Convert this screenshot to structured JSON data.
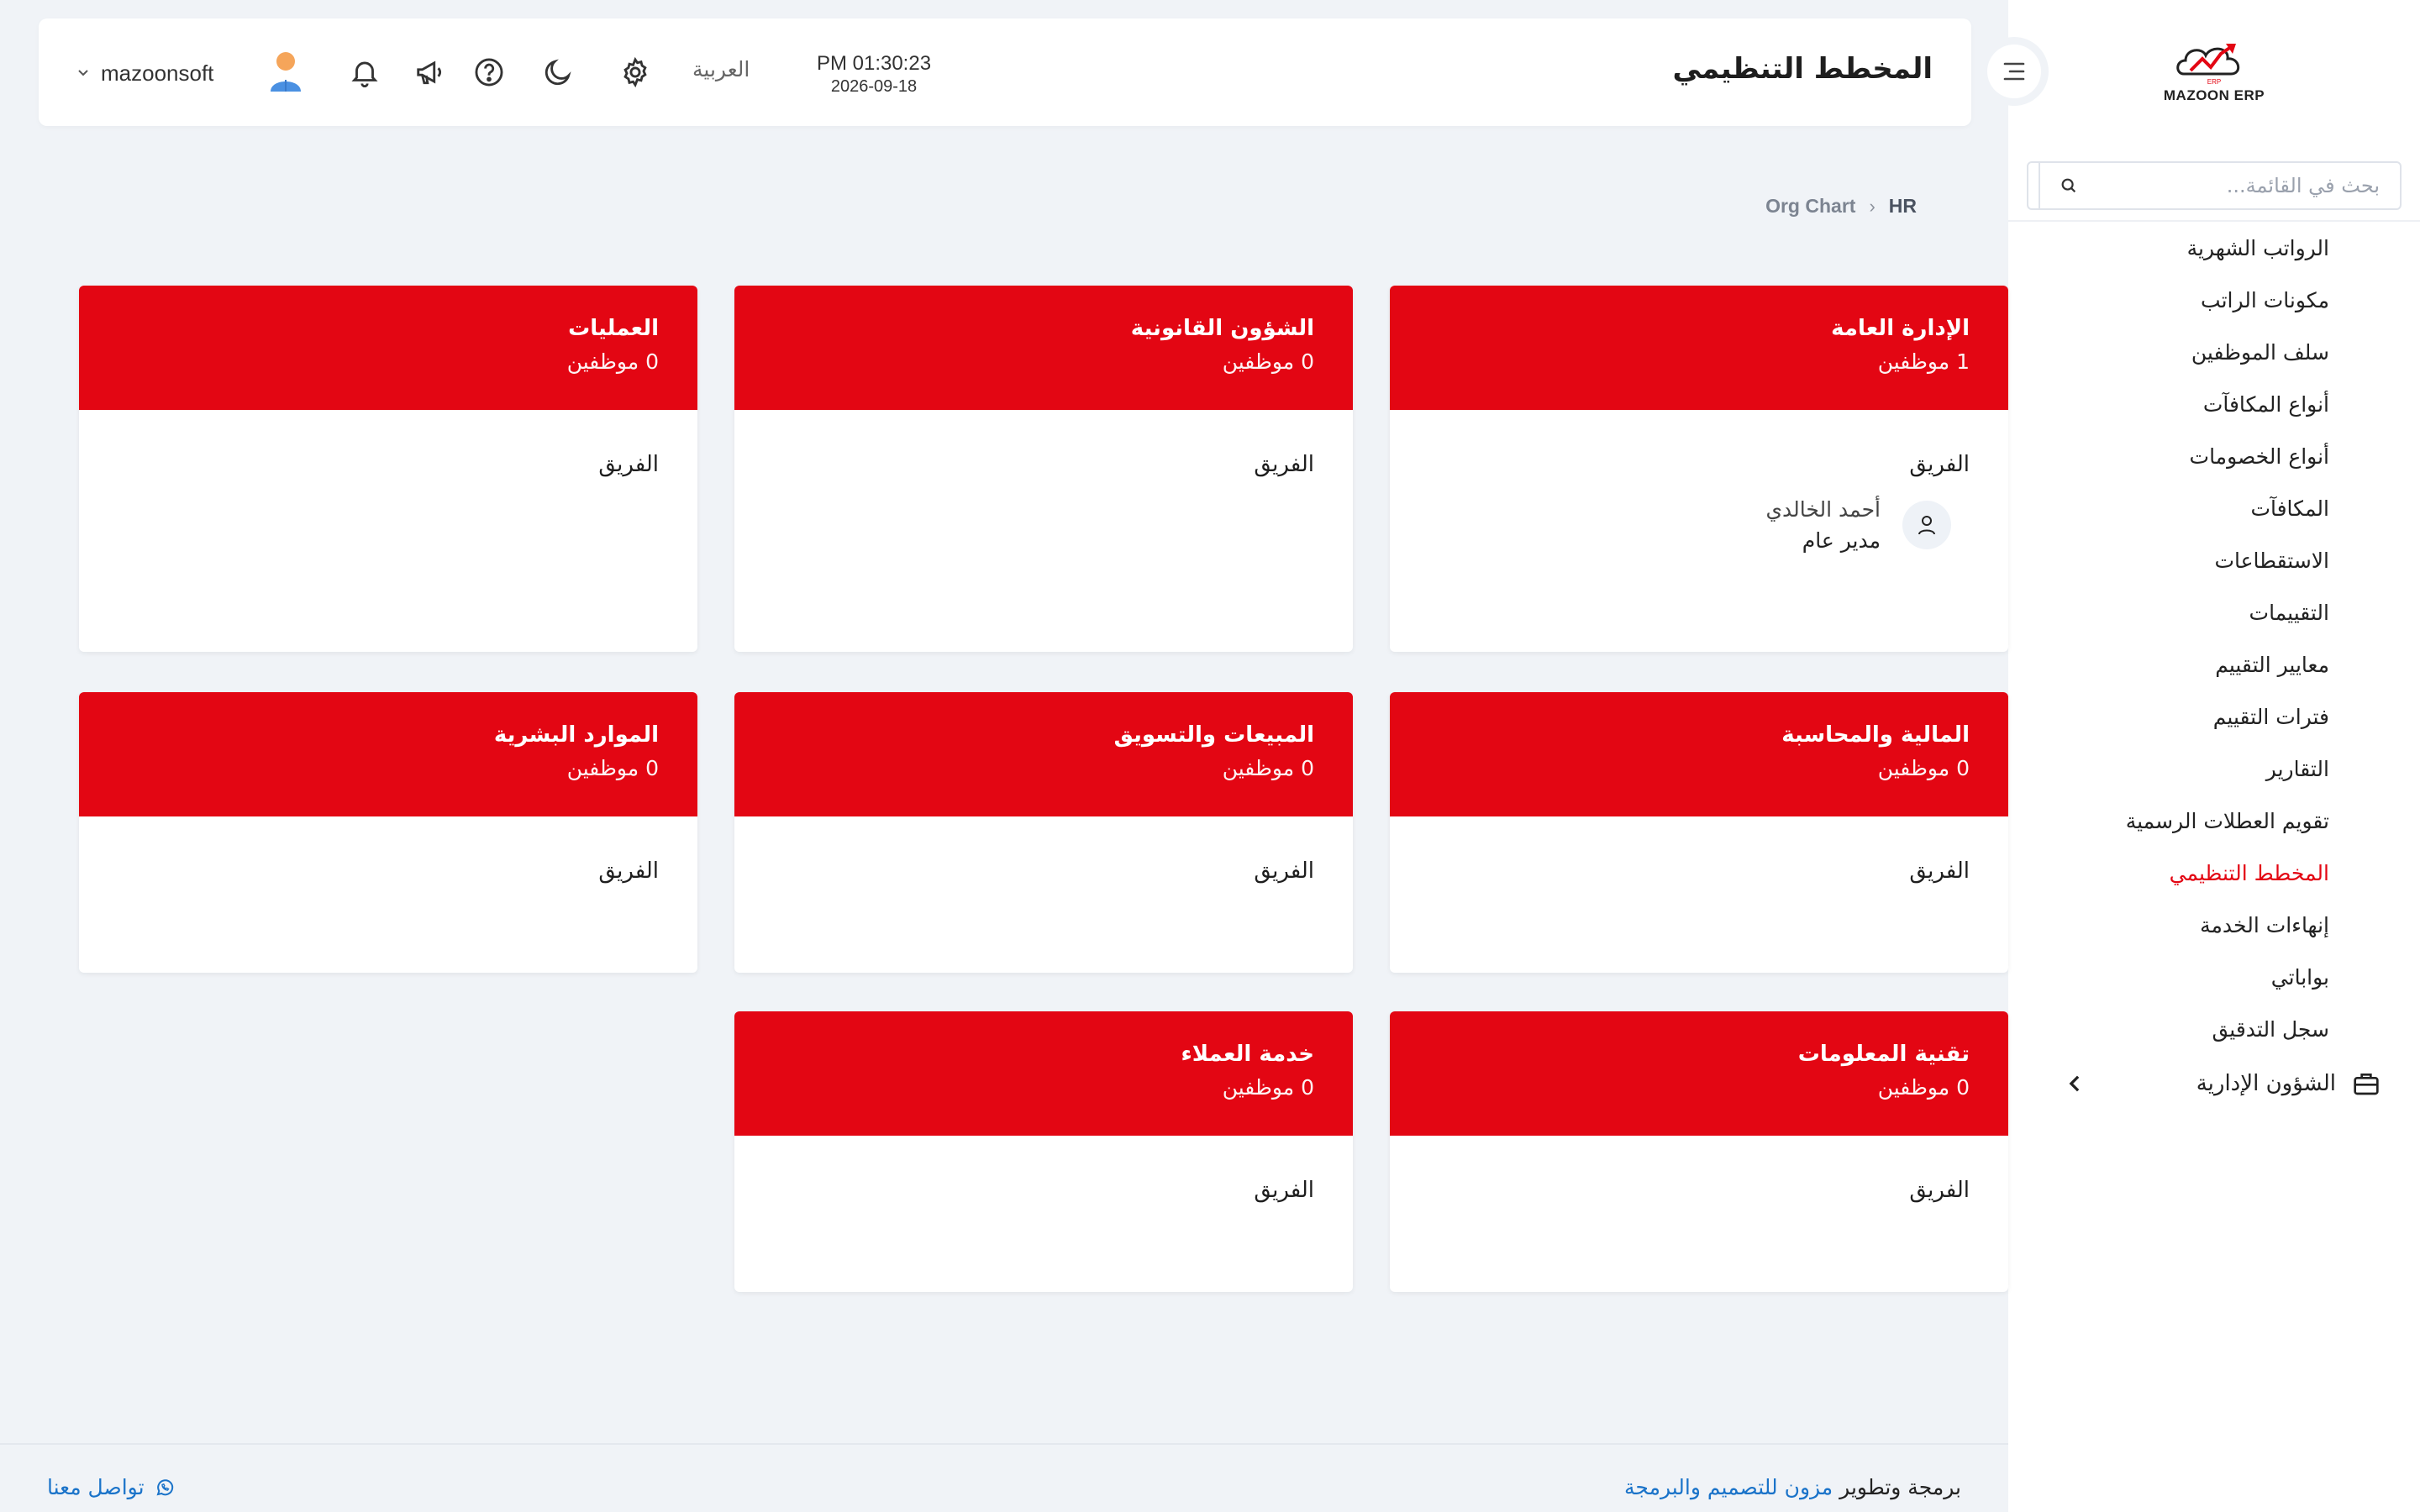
{
  "app": {
    "logo_text": "MAZOON ERP",
    "brand_color": "#e30613"
  },
  "sidebar": {
    "search_placeholder": "بحث في القائمة...",
    "items": [
      {
        "label": "الرواتب الشهرية"
      },
      {
        "label": "مكونات الراتب"
      },
      {
        "label": "سلف الموظفين"
      },
      {
        "label": "أنواع المكافآت"
      },
      {
        "label": "أنواع الخصومات"
      },
      {
        "label": "المكافآت"
      },
      {
        "label": "الاستقطاعات"
      },
      {
        "label": "التقييمات"
      },
      {
        "label": "معايير التقييم"
      },
      {
        "label": "فترات التقييم"
      },
      {
        "label": "التقارير"
      },
      {
        "label": "تقويم العطلات الرسمية"
      },
      {
        "label": "المخطط التنظيمي",
        "active": true
      },
      {
        "label": "إنهاءات الخدمة"
      },
      {
        "label": "بواباتي"
      },
      {
        "label": "سجل التدقيق"
      }
    ],
    "group": {
      "label": "الشؤون الإدارية",
      "icon": "briefcase-icon"
    }
  },
  "header": {
    "title": "المخطط التنظيمي",
    "time": "PM 01:30:23",
    "date": "2026-09-18",
    "language": "العربية",
    "username": "mazoonsoft",
    "icons": [
      "gear-icon",
      "moon-icon",
      "help-icon",
      "megaphone-icon",
      "bell-icon"
    ]
  },
  "breadcrumb": {
    "root": "HR",
    "current": "Org Chart"
  },
  "departments": [
    {
      "name": "الإدارة العامة",
      "count": "1 موظفين",
      "team_label": "الفريق",
      "members": [
        {
          "name": "أحمد الخالدي",
          "role": "مدير عام"
        }
      ]
    },
    {
      "name": "الشؤون القانونية",
      "count": "0 موظفين",
      "team_label": "الفريق",
      "members": []
    },
    {
      "name": "العمليات",
      "count": "0 موظفين",
      "team_label": "الفريق",
      "members": []
    },
    {
      "name": "المالية والمحاسبة",
      "count": "0 موظفين",
      "team_label": "الفريق",
      "members": []
    },
    {
      "name": "المبيعات والتسويق",
      "count": "0 موظفين",
      "team_label": "الفريق",
      "members": []
    },
    {
      "name": "الموارد البشرية",
      "count": "0 موظفين",
      "team_label": "الفريق",
      "members": []
    },
    {
      "name": "تقنية المعلومات",
      "count": "0 موظفين",
      "team_label": "الفريق",
      "members": []
    },
    {
      "name": "خدمة العملاء",
      "count": "0 موظفين",
      "team_label": "الفريق",
      "members": []
    }
  ],
  "footer": {
    "credit_prefix": "برمجة وتطوير",
    "credit_link": "مزون للتصميم والبرمجة",
    "contact": "تواصل معنا"
  }
}
